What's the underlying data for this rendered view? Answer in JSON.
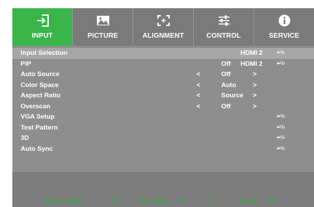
{
  "tabs": [
    {
      "label": "INPUT",
      "icon": "input-icon",
      "active": true
    },
    {
      "label": "PICTURE",
      "icon": "picture-icon",
      "active": false
    },
    {
      "label": "ALIGNMENT",
      "icon": "alignment-icon",
      "active": false
    },
    {
      "label": "CONTROL",
      "icon": "control-icon",
      "active": false
    },
    {
      "label": "SERVICE",
      "icon": "service-icon",
      "active": false
    }
  ],
  "menu": {
    "rows": [
      {
        "label": "Input Selection",
        "value": "HDMI 2",
        "enter": "↵/›",
        "selected": true
      },
      {
        "label": "PIP",
        "value": "Off",
        "value2": "HDMI 2",
        "enter": "↵/›"
      },
      {
        "label": "Auto Source",
        "left": "<",
        "value": "Off",
        "right": ">"
      },
      {
        "label": "Color Space",
        "left": "<",
        "value": "Auto",
        "right": ">"
      },
      {
        "label": "Aspect Ratio",
        "left": "<",
        "value": "Source",
        "right": ">"
      },
      {
        "label": "Overscan",
        "left": "<",
        "value": "Off",
        "right": ">"
      },
      {
        "label": "VGA Setup",
        "enter": "↵/›"
      },
      {
        "label": "Test Pattern",
        "enter": "↵/›"
      },
      {
        "label": "3D",
        "enter": "↵/›"
      },
      {
        "label": "Auto Sync",
        "enter": "↵/›"
      }
    ]
  },
  "footer": {
    "menu_back": "MENU = Back",
    "item_adjust": "Item  Adjust",
    "item_adjust_icon": "◂▸",
    "scroll": "Scroll",
    "scroll_icon": "▴▾"
  },
  "colors": {
    "active_tab": "#39b54a",
    "inactive_tab": "#7a7a7a",
    "panel": "#8e8e8e",
    "selected_row": "#a7a7a7",
    "footer": "#7d7d7d",
    "footer_text": "#2eaa3f"
  }
}
